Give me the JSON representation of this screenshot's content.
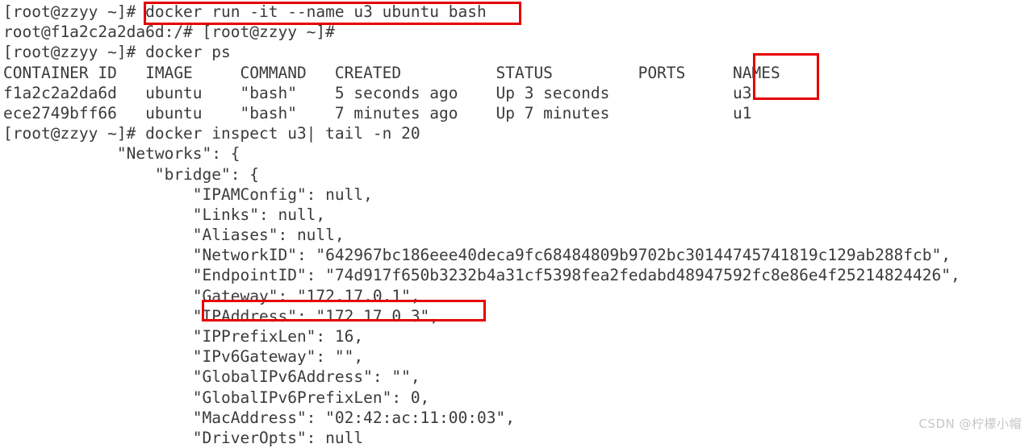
{
  "terminal": {
    "prompt_user_host": "[root@zzyy ~]#",
    "container_prompt": "root@f1a2c2a2da6d:/#",
    "lines": [
      "[root@zzyy ~]# docker run -it --name u3 ubuntu bash",
      "root@f1a2c2a2da6d:/# [root@zzyy ~]#",
      "[root@zzyy ~]# docker ps",
      "CONTAINER ID   IMAGE     COMMAND   CREATED          STATUS         PORTS     NAMES",
      "f1a2c2a2da6d   ubuntu    \"bash\"    5 seconds ago    Up 3 seconds             u3",
      "ece2749bff66   ubuntu    \"bash\"    7 minutes ago    Up 7 minutes             u1",
      "[root@zzyy ~]# docker inspect u3| tail -n 20",
      "            \"Networks\": {",
      "                \"bridge\": {",
      "                    \"IPAMConfig\": null,",
      "                    \"Links\": null,",
      "                    \"Aliases\": null,",
      "                    \"NetworkID\": \"642967bc186eee40deca9fc68484809b9702bc30144745741819c129ab288fcb\",",
      "                    \"EndpointID\": \"74d917f650b3232b4a31cf5398fea2fedabd48947592fc8e86e4f25214824426\",",
      "                    \"Gateway\": \"172.17.0.1\",",
      "                    \"IPAddress\": \"172.17.0.3\",",
      "                    \"IPPrefixLen\": 16,",
      "                    \"IPv6Gateway\": \"\",",
      "                    \"GlobalIPv6Address\": \"\",",
      "                    \"GlobalIPv6PrefixLen\": 0,",
      "                    \"MacAddress\": \"02:42:ac:11:00:03\",",
      "                    \"DriverOpts\": null"
    ],
    "commands": {
      "docker_run": "docker run -it --name u3 ubuntu bash",
      "docker_ps": "docker ps",
      "docker_inspect": "docker inspect u3| tail -n 20"
    },
    "docker_ps_table": {
      "headers": [
        "CONTAINER ID",
        "IMAGE",
        "COMMAND",
        "CREATED",
        "STATUS",
        "PORTS",
        "NAMES"
      ],
      "rows": [
        {
          "container_id": "f1a2c2a2da6d",
          "image": "ubuntu",
          "command": "\"bash\"",
          "created": "5 seconds ago",
          "status": "Up 3 seconds",
          "ports": "",
          "names": "u3"
        },
        {
          "container_id": "ece2749bff66",
          "image": "ubuntu",
          "command": "\"bash\"",
          "created": "7 minutes ago",
          "status": "Up 7 minutes",
          "ports": "",
          "names": "u1"
        }
      ]
    },
    "inspect_network": {
      "section": "Networks",
      "network_name": "bridge",
      "IPAMConfig": "null",
      "Links": "null",
      "Aliases": "null",
      "NetworkID": "642967bc186eee40deca9fc68484809b9702bc30144745741819c129ab288fcb",
      "EndpointID": "74d917f650b3232b4a31cf5398fea2fedabd48947592fc8e86e4f25214824426",
      "Gateway": "172.17.0.1",
      "IPAddress": "172.17.0.3",
      "IPPrefixLen": "16",
      "IPv6Gateway": "",
      "GlobalIPv6Address": "",
      "GlobalIPv6PrefixLen": "0",
      "MacAddress": "02:42:ac:11:00:03",
      "DriverOpts": "null"
    }
  },
  "annotations": {
    "color": "#e60000",
    "boxes": [
      {
        "name": "docker-run-command",
        "target": "docker run -it --name u3 ubuntu bash"
      },
      {
        "name": "names-column",
        "target": "NAMES u3"
      },
      {
        "name": "ip-address-line",
        "target": "\"IPAddress\": \"172.17.0.3\","
      }
    ]
  },
  "watermark": {
    "text": "CSDN @柠檬小帽"
  },
  "colors": {
    "background": "#ffffff",
    "text": "#3b3b3b",
    "annotation": "#e60000",
    "watermark": "#c6c6c6"
  }
}
